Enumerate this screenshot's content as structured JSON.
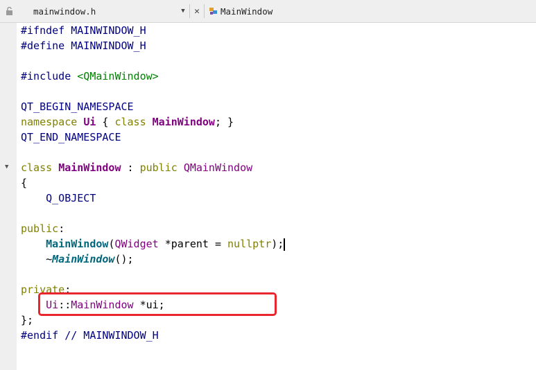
{
  "tabbar": {
    "file_name": "mainwindow.h",
    "class_name": "MainWindow"
  },
  "code": {
    "l1_a": "#ifndef",
    "l1_b": "MAINWINDOW_H",
    "l2_a": "#define",
    "l2_b": "MAINWINDOW_H",
    "l4_a": "#include",
    "l4_b": "<QMainWindow>",
    "l6": "QT_BEGIN_NAMESPACE",
    "l7_ns": "namespace",
    "l7_ui": "Ui",
    "l7_brace_open": "{",
    "l7_class": "class",
    "l7_name": "MainWindow",
    "l7_end": "; }",
    "l8": "QT_END_NAMESPACE",
    "l10_class": "class",
    "l10_name": "MainWindow",
    "l10_colon": " : ",
    "l10_public": "public",
    "l10_base": "QMainWindow",
    "l11": "{",
    "l12": "Q_OBJECT",
    "l14_public": "public",
    "l14_colon": ":",
    "l15_fn": "MainWindow",
    "l15_open": "(",
    "l15_type": "QWidget",
    "l15_param": " *parent = ",
    "l15_null": "nullptr",
    "l15_close": ");",
    "l16_tilde": "~",
    "l16_fn": "MainWindow",
    "l16_end": "();",
    "l18_private": "private",
    "l18_colon": ":",
    "l19_ui": "Ui",
    "l19_scope": "::",
    "l19_type": "MainWindow",
    "l19_rest": " *ui;",
    "l20": "};",
    "l21_a": "#endif",
    "l21_b": "// MAINWINDOW_H"
  },
  "colors": {
    "keyword": "#808000",
    "preprocessor": "#000080",
    "string": "#008000",
    "type": "#800080",
    "function": "#00677c",
    "highlight_border": "#e8262d"
  }
}
